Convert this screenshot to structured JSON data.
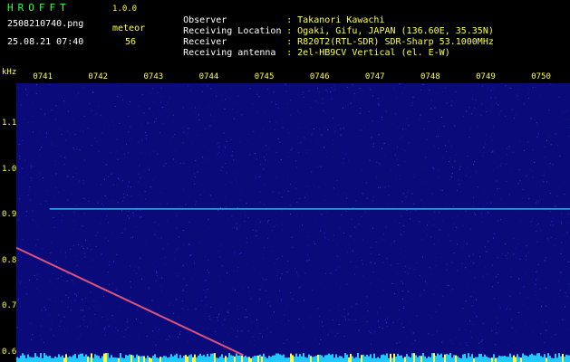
{
  "app": {
    "name": "HROFFT",
    "version": "1.0.0"
  },
  "meta": {
    "filename": "2508210740.png",
    "datetime": "25.08.21 07:40",
    "meteor_label": "meteor",
    "meteor_count": "56"
  },
  "fields": [
    {
      "label": "Observer",
      "value": ": Takanori Kawachi"
    },
    {
      "label": "Receiving Location",
      "value": ": Ogaki, Gifu, JAPAN (136.60E, 35.35N)"
    },
    {
      "label": "Receiver",
      "value": ": R820T2(RTL-SDR) SDR-Sharp 53.1000MHz"
    },
    {
      "label": "Receiving antenna",
      "value": ": 2el-HB9CV Vertical (el. E-W)"
    }
  ],
  "colors": {
    "accent": "#ffff40",
    "logo": "#3cff3c",
    "bg_noise": "#0a0a7a"
  },
  "chart_data": {
    "type": "heatmap",
    "ylabel": "kHz",
    "yticks": [
      "1.1",
      "1.0",
      "0.9",
      "0.8",
      "0.7",
      "0.6"
    ],
    "ytick_values": [
      1.1,
      1.0,
      0.9,
      0.8,
      0.7,
      0.6
    ],
    "ylim": [
      0.58,
      1.19
    ],
    "xticks": [
      "0741",
      "0742",
      "0743",
      "0744",
      "0745",
      "0746",
      "0747",
      "0748",
      "0749",
      "0750"
    ],
    "xlim": [
      0,
      10
    ],
    "traces": [
      {
        "kind": "carrier",
        "x": [
          0.6,
          10
        ],
        "y": [
          0.915,
          0.915
        ]
      },
      {
        "kind": "drift",
        "x": [
          0,
          4.1
        ],
        "y": [
          0.83,
          0.595
        ]
      }
    ]
  }
}
